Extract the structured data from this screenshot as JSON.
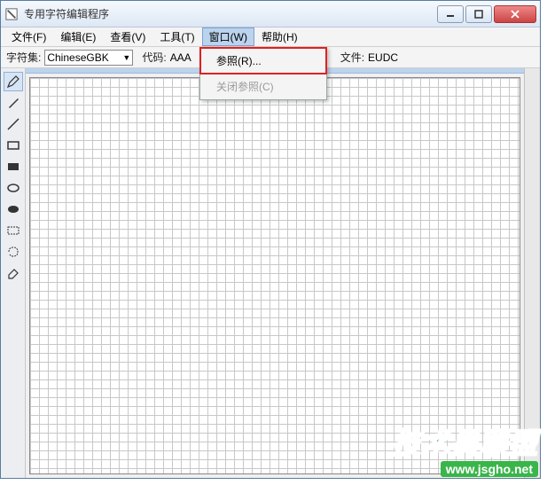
{
  "window": {
    "title": "专用字符编辑程序"
  },
  "menubar": {
    "file": "文件(F)",
    "edit": "编辑(E)",
    "view": "查看(V)",
    "tools": "工具(T)",
    "window": "窗口(W)",
    "help": "帮助(H)"
  },
  "toolbar": {
    "charset_label": "字符集:",
    "charset_value": "ChineseGBK",
    "code_label": "代码:",
    "code_value": "AAA",
    "file_label": "文件:",
    "file_value": "EUDC"
  },
  "dropdown": {
    "reference": "参照(R)...",
    "close_reference": "关闭参照(C)"
  },
  "watermark": {
    "brand": "技术员联盟",
    "url": "www.jsgho.net"
  }
}
